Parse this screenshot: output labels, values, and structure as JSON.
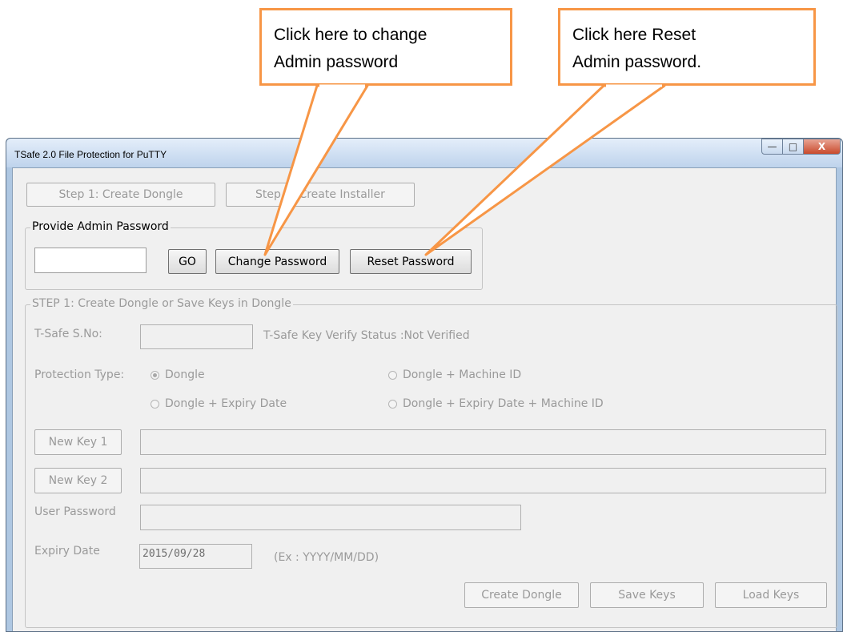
{
  "callouts": {
    "change": {
      "line1": "Click here to change",
      "line2": "Admin password"
    },
    "reset": {
      "line1": "Click here Reset",
      "line2": "Admin password."
    }
  },
  "window": {
    "title": "TSafe 2.0 File Protection for PuTTY",
    "controls": {
      "minimize": "—",
      "maximize": "□",
      "close": "X"
    }
  },
  "steps": {
    "step1": "Step 1: Create Dongle",
    "step2": "Step 2: Create Installer"
  },
  "admin": {
    "legend": "Provide Admin Password",
    "password_value": "",
    "go": "GO",
    "change": "Change Password",
    "reset": "Reset Password"
  },
  "step1_group": {
    "legend": "STEP 1: Create Dongle or Save Keys in Dongle",
    "sno_label": "T-Safe S.No:",
    "sno_value": "",
    "verify_status": "T-Safe Key Verify Status :Not Verified",
    "protection_label": "Protection Type:",
    "radios": {
      "dongle": "Dongle",
      "dongle_machine": "Dongle + Machine ID",
      "dongle_expiry": "Dongle + Expiry Date",
      "dongle_expiry_machine": "Dongle + Expiry Date + Machine ID"
    },
    "selected_protection": "Dongle",
    "new_key1": "New Key 1",
    "key1_value": "",
    "new_key2": "New Key 2",
    "key2_value": "",
    "user_password_label": "User Password",
    "user_password_value": "",
    "expiry_label": "Expiry Date",
    "expiry_value": "2015/09/28",
    "expiry_hint": "(Ex : YYYY/MM/DD)",
    "create_dongle": "Create Dongle",
    "save_keys": "Save Keys",
    "load_keys": "Load Keys"
  },
  "colors": {
    "callout_border": "#f79646"
  }
}
